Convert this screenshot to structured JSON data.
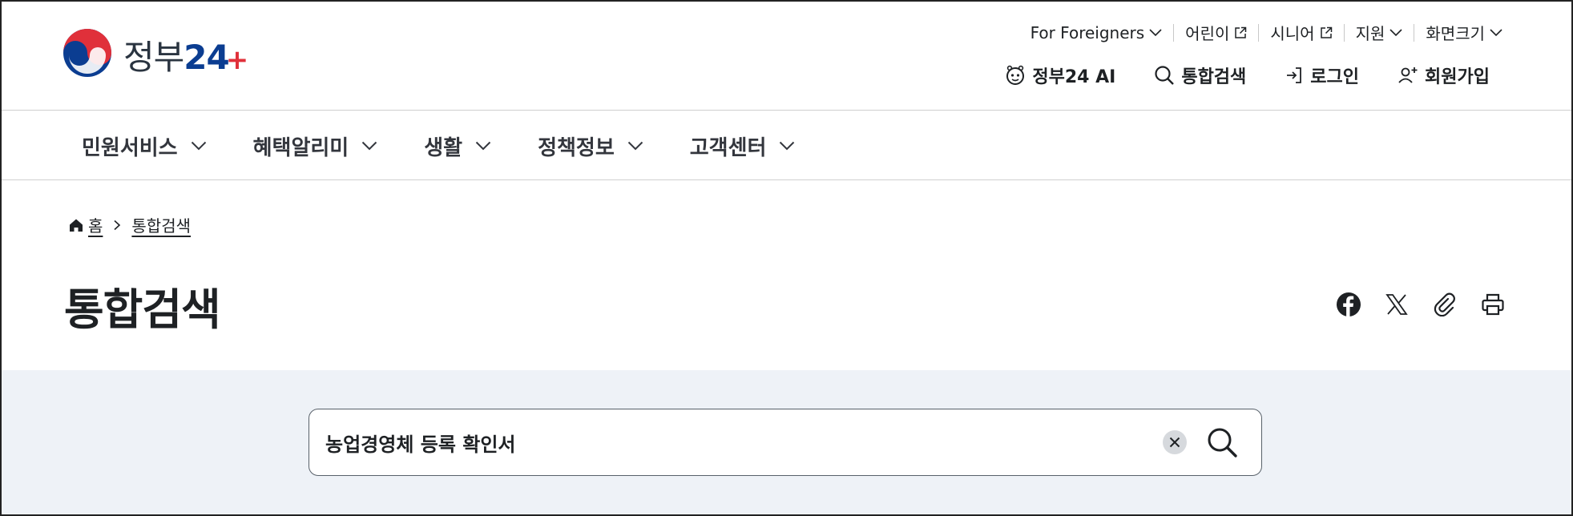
{
  "header": {
    "logo": {
      "text": "정부",
      "number": "24",
      "plus": "+"
    },
    "utility": [
      {
        "label": "For Foreigners",
        "icon": "chevron-down-icon"
      },
      {
        "label": "어린이",
        "icon": "external-link-icon"
      },
      {
        "label": "시니어",
        "icon": "external-link-icon"
      },
      {
        "label": "지원",
        "icon": "chevron-down-icon"
      },
      {
        "label": "화면크기",
        "icon": "chevron-down-icon"
      }
    ],
    "quick": [
      {
        "label": "정부24 AI",
        "icon": "ai-bot-icon"
      },
      {
        "label": "통합검색",
        "icon": "search-icon"
      },
      {
        "label": "로그인",
        "icon": "login-icon"
      },
      {
        "label": "회원가입",
        "icon": "user-plus-icon"
      }
    ]
  },
  "gnb": [
    {
      "label": "민원서비스"
    },
    {
      "label": "혜택알리미"
    },
    {
      "label": "생활"
    },
    {
      "label": "정책정보"
    },
    {
      "label": "고객센터"
    }
  ],
  "breadcrumb": {
    "home": "홈",
    "current": "통합검색"
  },
  "page_title": "통합검색",
  "share_icons": [
    "facebook-icon",
    "x-icon",
    "link-clip-icon",
    "print-icon"
  ],
  "search": {
    "value": "농업경영체 등록 확인서"
  },
  "colors": {
    "logo_red": "#e0303a",
    "logo_blue": "#0b3d91",
    "band_bg": "#eef2f7",
    "text": "#1e2124"
  }
}
